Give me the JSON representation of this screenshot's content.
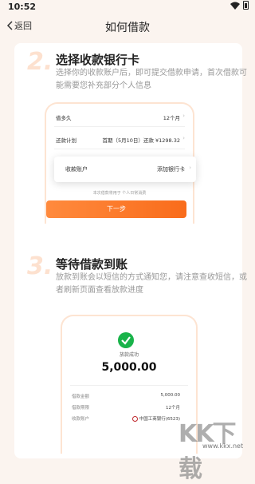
{
  "status": {
    "time": "10:52"
  },
  "nav": {
    "back_label": "返回",
    "title": "如何借款"
  },
  "step2": {
    "number": "2.",
    "title": "选择收款银行卡",
    "description": "选择你的收款账户后，即可提交借款申请，首次借款可能需要您补充部分个人信息"
  },
  "form": {
    "rows": [
      {
        "label": "借多久",
        "value": "12个月"
      },
      {
        "label": "还款计划",
        "value": "首期（5月10日）还款 ¥1298.32"
      }
    ],
    "bank_label": "收款账户",
    "bank_value": "添加银行卡",
    "note": "本次借款将用于 个人日常消费",
    "next_button": "下一步"
  },
  "step3": {
    "number": "3.",
    "title": "等待借款到账",
    "description": "放款到账会以短信的方式通知您，请注意查收短信，或者刷新页面查看放款进度"
  },
  "result": {
    "status": "放款成功",
    "amount": "5,000.00",
    "rows": [
      {
        "label": "借款金额",
        "value": "5,000.00"
      },
      {
        "label": "借款期限",
        "value": "12个月"
      },
      {
        "label": "收款账户",
        "value": "中国工商银行(6523)"
      }
    ]
  },
  "watermark": {
    "text": "KK下载",
    "url": "www.kkx.net"
  },
  "colors": {
    "accent": "#f96c1b",
    "success": "#19b34a",
    "step_number": "#fde1cf"
  }
}
